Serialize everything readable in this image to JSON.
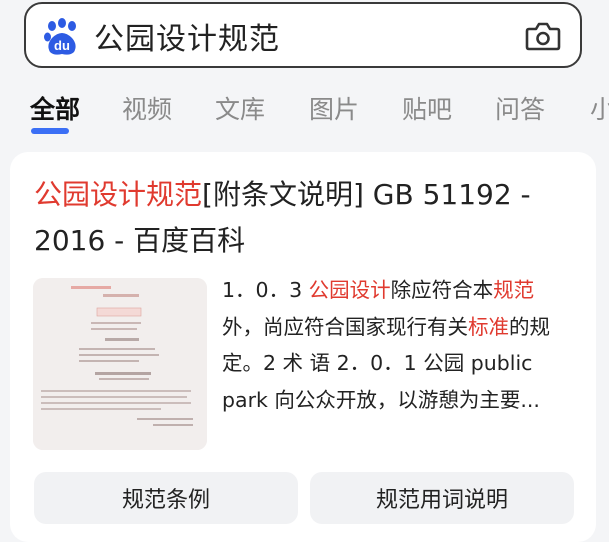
{
  "search": {
    "query": "公园设计规范",
    "logo_icon": "baidu-paw-icon",
    "camera_icon": "camera-icon",
    "logo_text": "du"
  },
  "tabs": [
    "全部",
    "视频",
    "文库",
    "图片",
    "贴吧",
    "问答",
    "小"
  ],
  "active_tab": "全部",
  "result": {
    "title_parts": [
      {
        "text": "公园设计规范",
        "highlight": true
      },
      {
        "text": "[附条文说明] GB 51192 - 2016 - 百度百科",
        "highlight": false
      }
    ],
    "snippet_parts": [
      {
        "text": "1．0．3 ",
        "highlight": false
      },
      {
        "text": "公园设计",
        "highlight": true
      },
      {
        "text": "除应符合本",
        "highlight": false
      },
      {
        "text": "规范",
        "highlight": true
      },
      {
        "text": "外，尚应符合国家现行有关",
        "highlight": false
      },
      {
        "text": "标准",
        "highlight": true
      },
      {
        "text": "的规定。2 术 语 2．0．1 公园 public park 向公众开放，以游憩为主要...",
        "highlight": false
      }
    ],
    "thumbnail_alt": "document-thumbnail"
  },
  "chips": [
    "规范条例",
    "规范用词说明"
  ],
  "colors": {
    "accent": "#3b6ff5",
    "highlight": "#e03a2f",
    "baidu_blue": "#2d5be3"
  }
}
